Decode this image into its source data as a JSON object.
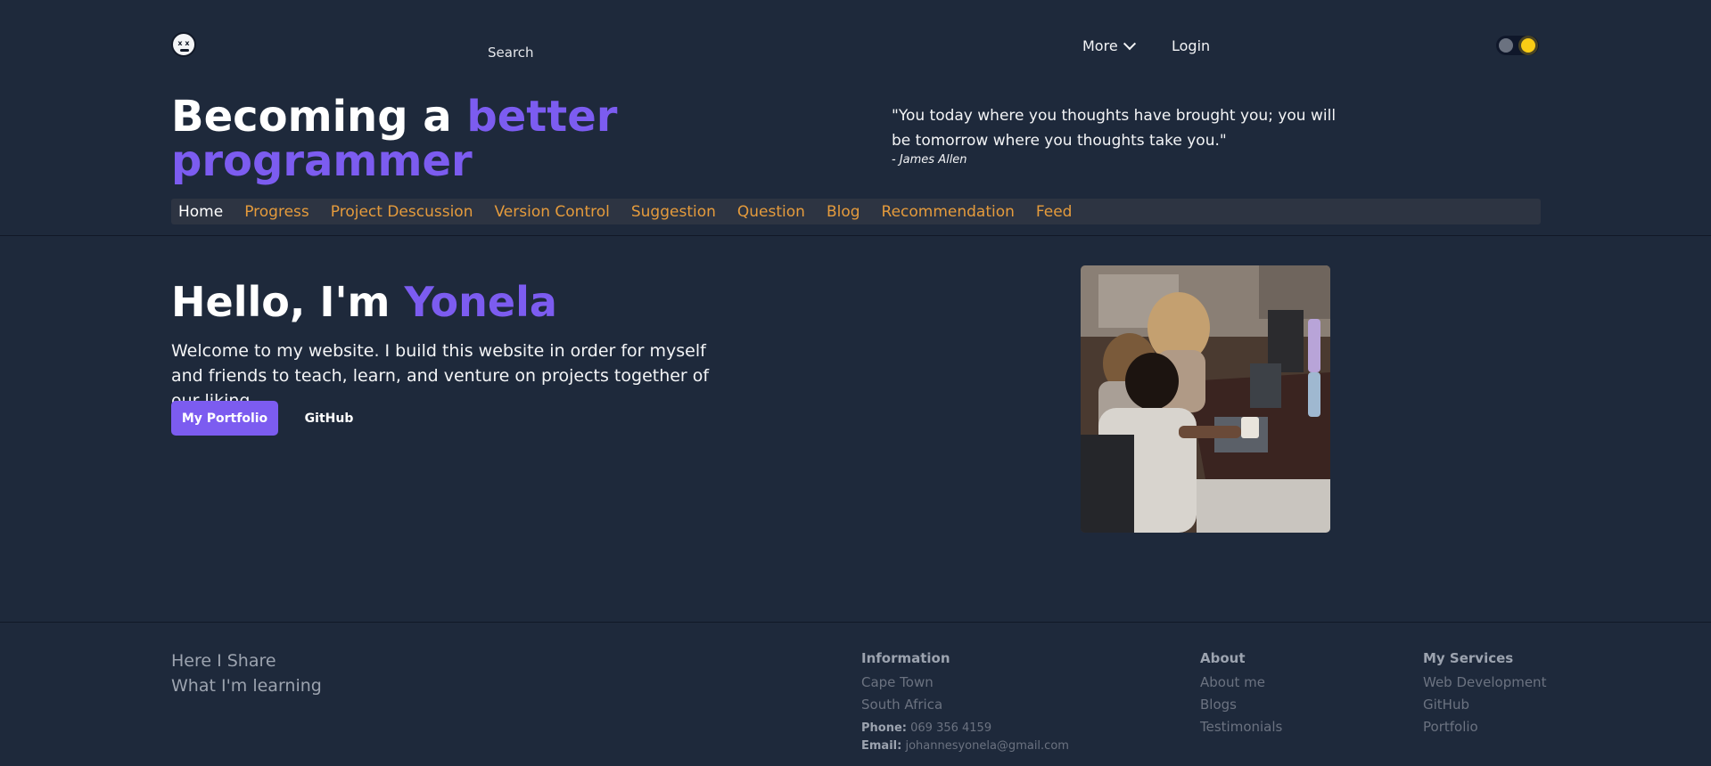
{
  "header": {
    "search_label": "Search",
    "more_label": "More",
    "login_label": "Login"
  },
  "hero": {
    "title_part1": "Becoming a ",
    "title_accent1": "better",
    "title_accent2": "programmer",
    "quote": "\"You today where you thoughts have brought you; you will be tomorrow where you thoughts take you.\"",
    "quote_author": "- James Allen"
  },
  "nav": {
    "items": [
      "Home",
      "Progress",
      "Project Descussion",
      "Version Control",
      "Suggestion",
      "Question",
      "Blog",
      "Recommendation",
      "Feed"
    ]
  },
  "intro": {
    "greeting": "Hello, I'm ",
    "name": "Yonela",
    "welcome": "Welcome to my website. I build this website in order for myself and friends to teach, learn, and venture on projects together of our liking.",
    "portfolio_button": "My Portfolio",
    "github_button": "GitHub"
  },
  "footer": {
    "tagline1": "Here I Share",
    "tagline2": "What I'm learning",
    "information": {
      "heading": "Information",
      "city": "Cape Town",
      "country": "South Africa",
      "phone_label": "Phone:",
      "phone": "069 356 4159",
      "email_label": "Email:",
      "email": "johannesyonela@gmail.com"
    },
    "about": {
      "heading": "About",
      "links": [
        "About me",
        "Blogs",
        "Testimonials"
      ]
    },
    "services": {
      "heading": "My Services",
      "links": [
        "Web Development",
        "GitHub",
        "Portfolio"
      ]
    }
  },
  "colors": {
    "background": "#1e293b",
    "accent": "#7c5cf0",
    "nav_link": "#e59b3c"
  }
}
